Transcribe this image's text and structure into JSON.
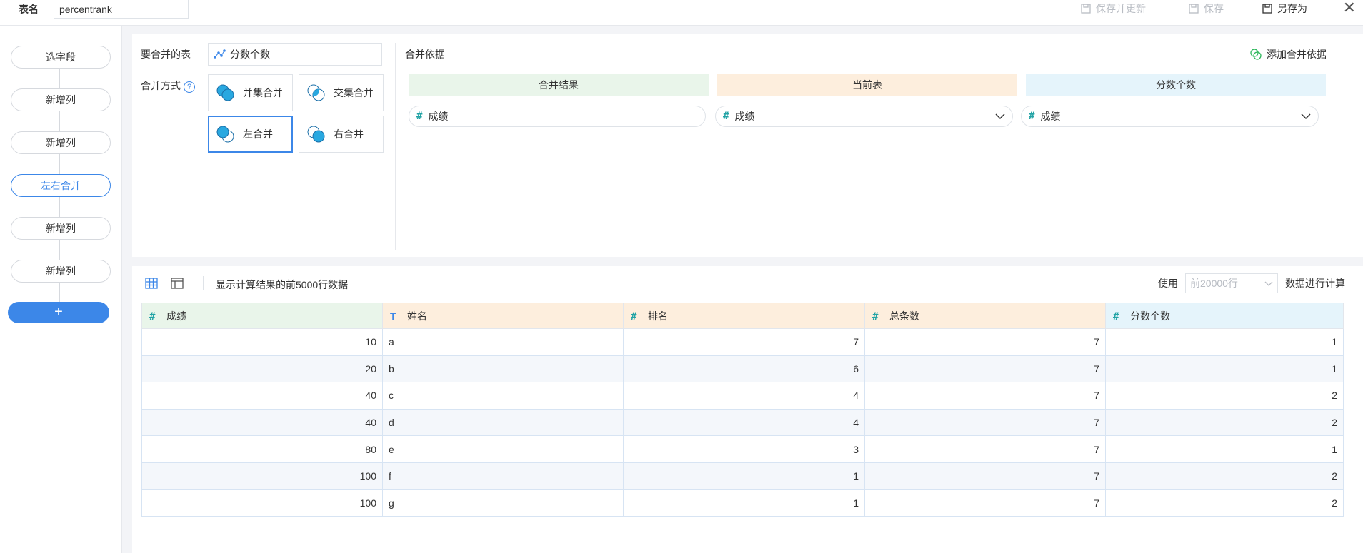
{
  "topbar": {
    "table_name_label": "表名",
    "table_name_value": "percentrank",
    "save_update": "保存并更新",
    "save": "保存",
    "save_as": "另存为"
  },
  "flow": {
    "steps": [
      "选字段",
      "新增列",
      "新增列",
      "左右合并",
      "新增列",
      "新增列"
    ],
    "active_index": 3,
    "add_label": "+"
  },
  "merge": {
    "source_label": "要合并的表",
    "source_table": "分数个数",
    "mode_label": "合并方式",
    "help": "?",
    "modes": [
      "并集合并",
      "交集合并",
      "左合并",
      "右合并"
    ],
    "selected_mode": "左合并",
    "basis_title": "合并依据",
    "add_basis": "添加合并依据",
    "headers": {
      "result": "合并结果",
      "current": "当前表",
      "other": "分数个数"
    },
    "fields": {
      "result": "成绩",
      "current": "成绩",
      "other": "成绩"
    }
  },
  "preview": {
    "info": "显示计算结果的前5000行数据",
    "use_label": "使用",
    "rows_placeholder": "前20000行",
    "calc_label": "数据进行计算",
    "columns": [
      {
        "type": "#",
        "name": "成绩",
        "tone": "green"
      },
      {
        "type": "T",
        "name": "姓名",
        "tone": "orange"
      },
      {
        "type": "#",
        "name": "排名",
        "tone": "orange"
      },
      {
        "type": "#",
        "name": "总条数",
        "tone": "orange"
      },
      {
        "type": "#",
        "name": "分数个数",
        "tone": "blue"
      }
    ],
    "rows": [
      [
        "10",
        "a",
        "7",
        "7",
        "1"
      ],
      [
        "20",
        "b",
        "6",
        "7",
        "1"
      ],
      [
        "40",
        "c",
        "4",
        "7",
        "2"
      ],
      [
        "40",
        "d",
        "4",
        "7",
        "2"
      ],
      [
        "80",
        "e",
        "3",
        "7",
        "1"
      ],
      [
        "100",
        "f",
        "1",
        "7",
        "2"
      ],
      [
        "100",
        "g",
        "1",
        "7",
        "2"
      ]
    ]
  },
  "colors": {
    "accent": "#3c87e8",
    "hash": "#22a3a5",
    "green_header": "#e9f5ea",
    "orange_header": "#fdeedd",
    "blue_header": "#e5f4fb"
  }
}
